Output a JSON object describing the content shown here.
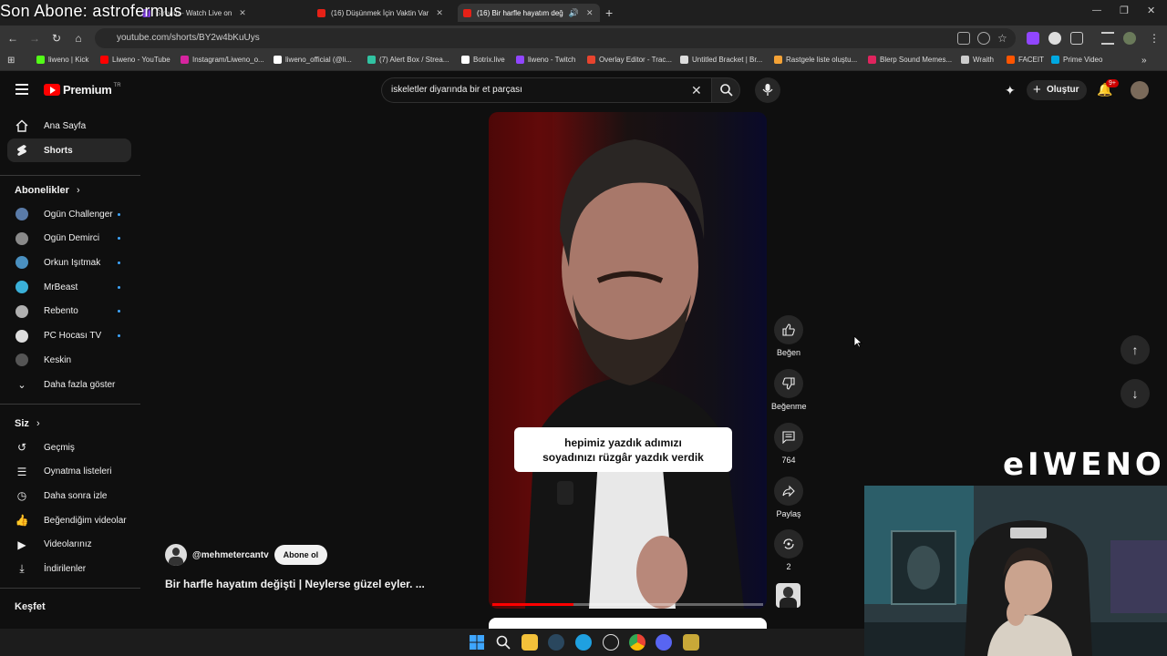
{
  "overlay": {
    "stream_text": "Son Abone: astrofermus",
    "brand": "eIWENO"
  },
  "browser": {
    "tabs": [
      {
        "label": "Stream - Watch Live on"
      },
      {
        "label": "(16) Düşünmek İçin Vaktin Var"
      },
      {
        "label": "(16) Bir harfle hayatım değ"
      }
    ],
    "url": "youtube.com/shorts/BY2w4bKuUys",
    "bookmarks": [
      {
        "label": "liweno | Kick",
        "color": "#53fc18"
      },
      {
        "label": "Liweno - YouTube",
        "color": "#ff0000"
      },
      {
        "label": "Instagram/Liweno_o...",
        "color": "#d6249f"
      },
      {
        "label": "liweno_official (@li...",
        "color": "#ffffff"
      },
      {
        "label": "(7) Alert Box / Strea...",
        "color": "#31c3a2"
      },
      {
        "label": "Botrix.live",
        "color": "#ffffff"
      },
      {
        "label": "liweno - Twitch",
        "color": "#9146ff"
      },
      {
        "label": "Overlay Editor - Trac...",
        "color": "#e8442e"
      },
      {
        "label": "Untitled Bracket | Br...",
        "color": "#dddddd"
      },
      {
        "label": "Rastgele liste oluştu...",
        "color": "#f4a236"
      },
      {
        "label": "Blerp Sound Memes...",
        "color": "#e0245e"
      },
      {
        "label": "Wraith",
        "color": "#cccccc"
      },
      {
        "label": "FACEIT",
        "color": "#ff5500"
      },
      {
        "label": "Prime Video",
        "color": "#00a8e1"
      }
    ]
  },
  "header": {
    "logo": "Premium",
    "logo_region": "TR",
    "search_query": "iskeletler diyarında bir et parçası",
    "create_label": "Oluştur",
    "notification_count": "9+"
  },
  "sidebar": {
    "home": "Ana Sayfa",
    "shorts": "Shorts",
    "subscriptions_title": "Abonelikler",
    "subscriptions": [
      {
        "label": "Ogün Challenger",
        "color": "#5a7ba8",
        "new": true
      },
      {
        "label": "Ogün Demirci",
        "color": "#8a8a8a",
        "new": true
      },
      {
        "label": "Orkun Işıtmak",
        "color": "#4a90c0",
        "new": true
      },
      {
        "label": "MrBeast",
        "color": "#3ab0d8",
        "new": true
      },
      {
        "label": "Rebento",
        "color": "#b0b0b0",
        "new": true
      },
      {
        "label": "PC Hocası TV",
        "color": "#dddddd",
        "new": true
      },
      {
        "label": "Keskin",
        "color": "#555555",
        "new": false
      }
    ],
    "show_more": "Daha fazla göster",
    "you_title": "Siz",
    "you_items": [
      {
        "label": "Geçmiş",
        "icon": "history-icon"
      },
      {
        "label": "Oynatma listeleri",
        "icon": "playlist-icon"
      },
      {
        "label": "Daha sonra izle",
        "icon": "clock-icon"
      },
      {
        "label": "Beğendiğim videolar",
        "icon": "thumbs-up-icon"
      },
      {
        "label": "Videolarınız",
        "icon": "video-icon"
      },
      {
        "label": "İndirilenler",
        "icon": "download-icon"
      }
    ],
    "explore_title": "Keşfet"
  },
  "short": {
    "caption_line1": "hepimiz yazdık adımızı",
    "caption_line2": "soyadınızı rüzgâr yazdık verdik",
    "channel": "@mehmetercantv",
    "subscribe": "Abone ol",
    "title": "Bir harfle hayatım değişti | Neylerse güzel eyler. ...",
    "like_label": "Beğen",
    "dislike_label": "Beğenme",
    "comments": "764",
    "share_label": "Paylaş",
    "remix_count": "2",
    "progress": 0.3
  }
}
